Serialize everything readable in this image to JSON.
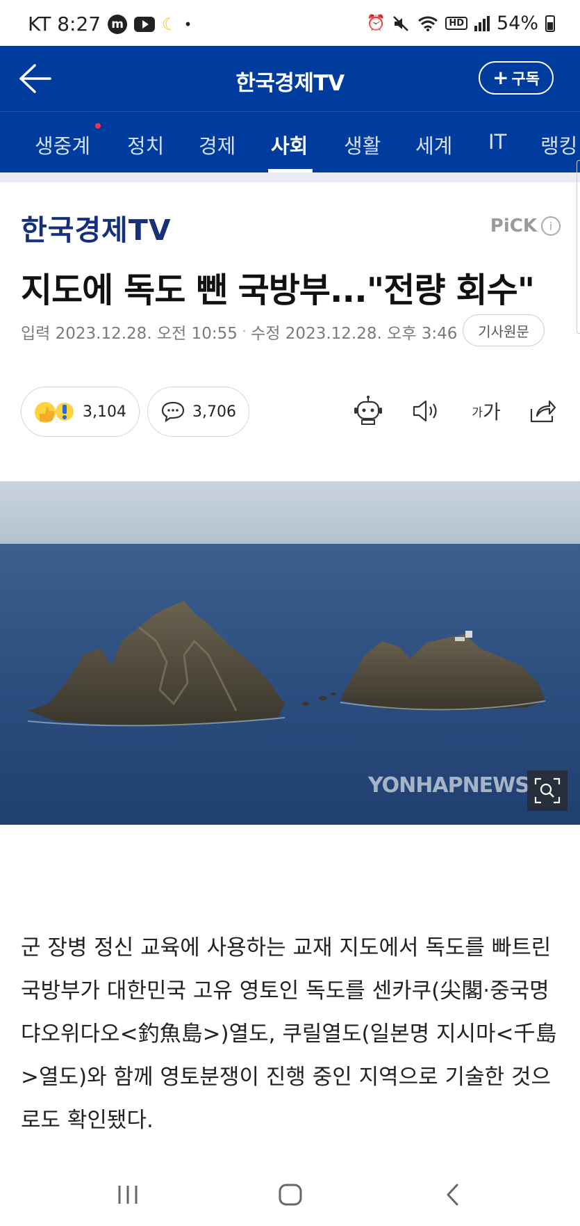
{
  "status_bar": {
    "carrier_time": "KT 8:27",
    "app_icon_m": "m",
    "battery": "54%",
    "icons": [
      "m-app-icon",
      "youtube-icon",
      "moon-icon",
      "dot",
      "alarm-icon",
      "mute-icon",
      "wifi-icon",
      "hd-icon",
      "signal-icon",
      "battery-icon"
    ]
  },
  "header": {
    "title": "한국경제TV",
    "subscribe_label": "구독"
  },
  "tabs": [
    {
      "label": "생중계",
      "active": false,
      "has_new_dot": true
    },
    {
      "label": "정치",
      "active": false
    },
    {
      "label": "경제",
      "active": false
    },
    {
      "label": "사회",
      "active": true
    },
    {
      "label": "생활",
      "active": false
    },
    {
      "label": "세계",
      "active": false
    },
    {
      "label": "IT",
      "active": false
    },
    {
      "label": "랭킹",
      "active": false
    }
  ],
  "article": {
    "press": "한국경제TV",
    "pick_label": "PiCK",
    "headline": "지도에 독도 뺀 국방부...\"전량 회수\"",
    "input_date": "입력 2023.12.28. 오전 10:55",
    "modified_date": "수정 2023.12.28. 오후 3:46",
    "original_label": "기사원문",
    "reaction_count": "3,104",
    "comment_count": "3,706",
    "font_icon_small": "가",
    "font_icon_large": "가",
    "image_watermark": "YONHAPNEWS",
    "body": "군 장병 정신 교육에 사용하는 교재 지도에서 독도를 빠트린 국방부가 대한민국 고유 영토인 독도를 센카쿠(尖閣·중국명 댜오위다오<釣魚島>)열도, 쿠릴열도(일본명 지시마<千島>열도)와 함께 영토분쟁이 진행 중인 지역으로 기술한 것으로도 확인됐다."
  },
  "colors": {
    "brand_blue": "#003b9e",
    "press_logo": "#16307a",
    "new_dot": "#ff2e4c"
  }
}
